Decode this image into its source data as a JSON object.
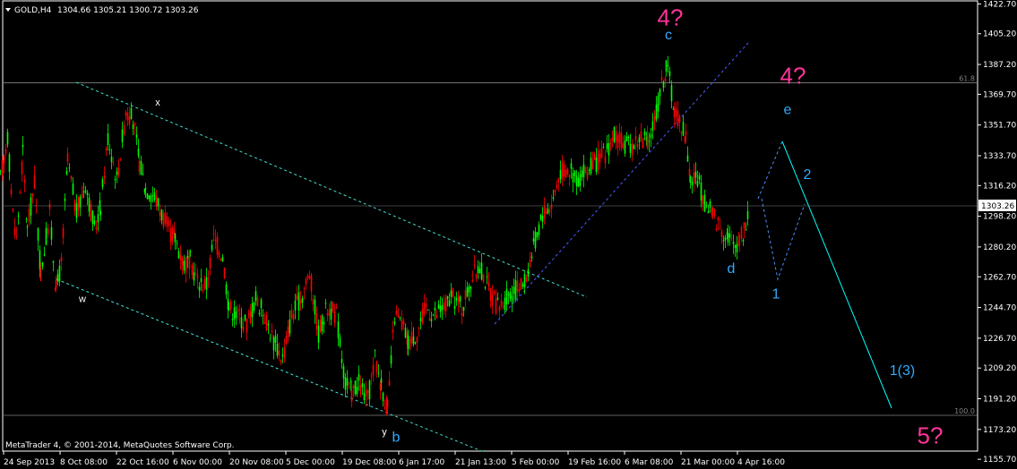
{
  "header": {
    "symbol_timeframe": "GOLD,H4",
    "ohlc": "1304.66 1305.21 1300.72 1303.26"
  },
  "footer": {
    "copyright": "MetaTrader 4, © 2001-2014, MetaQuotes Software Corp."
  },
  "colors": {
    "background": "#000000",
    "bull_candle": "#00ff00",
    "bear_candle": "#ff0000",
    "wick": "#ffffff",
    "channel_line": "#40e0d0",
    "trend_line": "#4a5cff",
    "projection_line": "#00ffff",
    "fib_line": "#808080",
    "wave_magenta": "#ff3399",
    "wave_blue": "#33aaff",
    "label_white": "#ffffff"
  },
  "chart_data": {
    "type": "candlestick",
    "title": "GOLD,H4",
    "ylim": [
      1150,
      1425
    ],
    "y_ticks": [
      "1422.70",
      "1405.20",
      "1387.20",
      "1369.70",
      "1351.70",
      "1333.70",
      "1316.20",
      "1298.20",
      "1280.20",
      "1262.70",
      "1244.70",
      "1226.70",
      "1209.20",
      "1191.20",
      "1173.20",
      "1155.70"
    ],
    "x_ticks": [
      "24 Sep 2013",
      "8 Oct 08:00",
      "22 Oct 16:00",
      "6 Nov 00:00",
      "20 Nov 08:00",
      "5 Dec 00:00",
      "19 Dec 08:00",
      "6 Jan 17:00",
      "21 Jan 13:00",
      "5 Feb 00:00",
      "19 Feb 16:00",
      "6 Mar 08:00",
      "21 Mar 00:00",
      "4 Apr 16:00"
    ],
    "current_price": "1303.26",
    "fib_levels": [
      {
        "label": "61.8",
        "price": 1376.5
      },
      {
        "label": "100.0",
        "price": 1181.5
      }
    ],
    "price_path": [
      [
        0,
        1320
      ],
      [
        8,
        1345
      ],
      [
        14,
        1300
      ],
      [
        18,
        1285
      ],
      [
        25,
        1335
      ],
      [
        30,
        1290
      ],
      [
        38,
        1318
      ],
      [
        45,
        1265
      ],
      [
        55,
        1300
      ],
      [
        62,
        1255
      ],
      [
        68,
        1270
      ],
      [
        75,
        1330
      ],
      [
        85,
        1300
      ],
      [
        95,
        1318
      ],
      [
        105,
        1290
      ],
      [
        112,
        1305
      ],
      [
        120,
        1345
      ],
      [
        130,
        1320
      ],
      [
        140,
        1360
      ],
      [
        148,
        1355
      ],
      [
        155,
        1330
      ],
      [
        162,
        1315
      ],
      [
        172,
        1310
      ],
      [
        180,
        1300
      ],
      [
        188,
        1290
      ],
      [
        195,
        1285
      ],
      [
        205,
        1270
      ],
      [
        212,
        1272
      ],
      [
        220,
        1260
      ],
      [
        230,
        1258
      ],
      [
        238,
        1285
      ],
      [
        248,
        1275
      ],
      [
        255,
        1245
      ],
      [
        265,
        1240
      ],
      [
        275,
        1235
      ],
      [
        285,
        1250
      ],
      [
        295,
        1240
      ],
      [
        305,
        1225
      ],
      [
        315,
        1215
      ],
      [
        325,
        1240
      ],
      [
        335,
        1250
      ],
      [
        345,
        1265
      ],
      [
        355,
        1230
      ],
      [
        365,
        1245
      ],
      [
        375,
        1240
      ],
      [
        385,
        1200
      ],
      [
        392,
        1195
      ],
      [
        400,
        1200
      ],
      [
        410,
        1190
      ],
      [
        418,
        1215
      ],
      [
        425,
        1200
      ],
      [
        432,
        1185
      ],
      [
        440,
        1240
      ],
      [
        448,
        1235
      ],
      [
        455,
        1225
      ],
      [
        465,
        1230
      ],
      [
        475,
        1245
      ],
      [
        485,
        1240
      ],
      [
        495,
        1245
      ],
      [
        505,
        1250
      ],
      [
        515,
        1245
      ],
      [
        525,
        1260
      ],
      [
        535,
        1270
      ],
      [
        545,
        1255
      ],
      [
        555,
        1245
      ],
      [
        565,
        1250
      ],
      [
        575,
        1255
      ],
      [
        585,
        1260
      ],
      [
        595,
        1280
      ],
      [
        605,
        1300
      ],
      [
        615,
        1305
      ],
      [
        625,
        1325
      ],
      [
        635,
        1325
      ],
      [
        645,
        1320
      ],
      [
        655,
        1325
      ],
      [
        665,
        1330
      ],
      [
        675,
        1335
      ],
      [
        685,
        1345
      ],
      [
        695,
        1340
      ],
      [
        705,
        1340
      ],
      [
        715,
        1345
      ],
      [
        722,
        1340
      ],
      [
        730,
        1355
      ],
      [
        738,
        1375
      ],
      [
        743,
        1385
      ],
      [
        747,
        1378
      ],
      [
        752,
        1360
      ],
      [
        758,
        1355
      ],
      [
        765,
        1345
      ],
      [
        770,
        1320
      ],
      [
        778,
        1320
      ],
      [
        786,
        1305
      ],
      [
        795,
        1300
      ],
      [
        805,
        1290
      ],
      [
        812,
        1288
      ],
      [
        818,
        1280
      ],
      [
        825,
        1285
      ],
      [
        830,
        1290
      ],
      [
        835,
        1303
      ]
    ],
    "annotations": [
      {
        "text": "4?",
        "price": 1410,
        "x_pos": "near 6 Mar 08:00",
        "color": "magenta"
      },
      {
        "text": "c",
        "price": 1402,
        "x_pos": "near 6 Mar 08:00",
        "color": "blue"
      },
      {
        "text": "4?",
        "price": 1376,
        "x_pos": "right of 4 Apr 16:00",
        "color": "magenta"
      },
      {
        "text": "e",
        "price": 1358,
        "x_pos": "right of 4 Apr 16:00",
        "color": "blue"
      },
      {
        "text": "2",
        "price": 1320,
        "x_pos": "right of 4 Apr 16:00",
        "color": "blue"
      },
      {
        "text": "d",
        "price": 1265,
        "x_pos": "near 21 Mar 00:00",
        "color": "blue"
      },
      {
        "text": "1",
        "price": 1250,
        "x_pos": "right of 4 Apr 16:00",
        "color": "blue"
      },
      {
        "text": "1(3)",
        "price": 1205,
        "x_pos": "far right",
        "color": "blue"
      },
      {
        "text": "5?",
        "price": 1165,
        "x_pos": "far right",
        "color": "magenta"
      },
      {
        "text": "x",
        "price": 1363,
        "x_pos": "near 22 Oct 16:00",
        "color": "white"
      },
      {
        "text": "w",
        "price": 1248,
        "x_pos": "near 8 Oct 08:00",
        "color": "white"
      },
      {
        "text": "y",
        "price": 1170,
        "x_pos": "near 6 Jan 17:00",
        "color": "white"
      },
      {
        "text": "b",
        "price": 1166,
        "x_pos": "near 6 Jan 17:00",
        "color": "blue"
      }
    ]
  }
}
